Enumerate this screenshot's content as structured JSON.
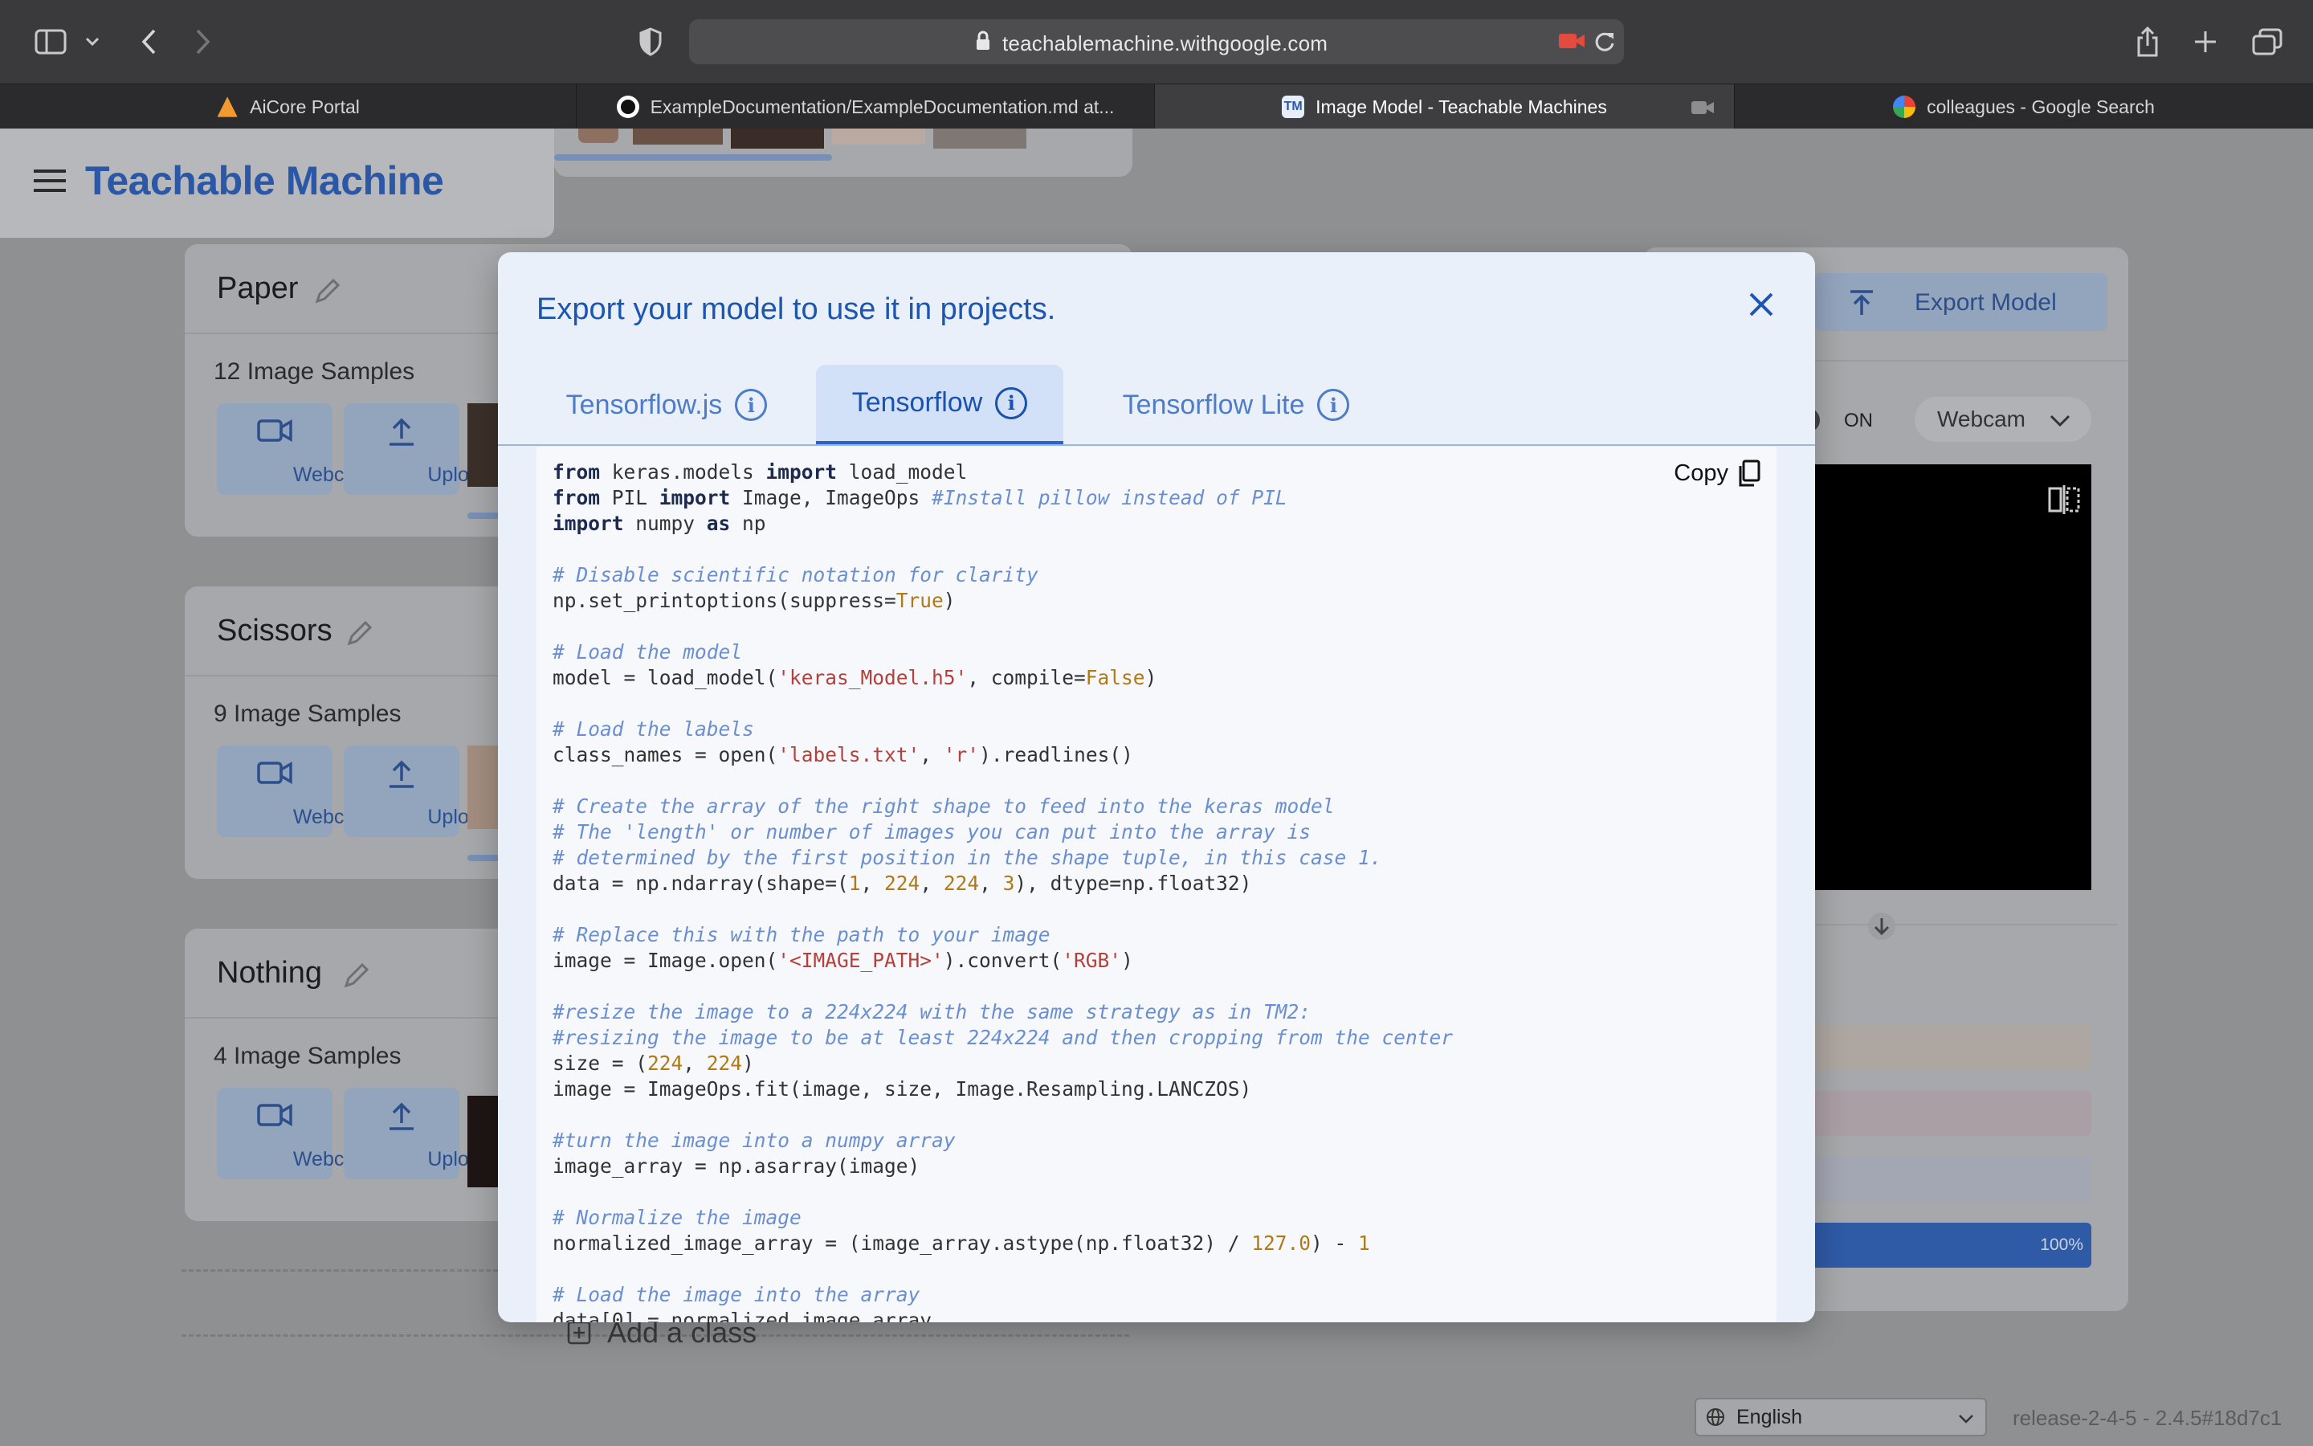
{
  "browser": {
    "url": "teachablemachine.withgoogle.com",
    "tabs": [
      {
        "title": "AiCore Portal"
      },
      {
        "title": "ExampleDocumentation/ExampleDocumentation.md at..."
      },
      {
        "title": "Image Model - Teachable Machines"
      },
      {
        "title": "colleagues - Google Search"
      }
    ]
  },
  "app": {
    "logo": "Teachable Machine",
    "classes": [
      {
        "name": "Paper",
        "samples": "12 Image Samples"
      },
      {
        "name": "Scissors",
        "samples": "9 Image Samples"
      },
      {
        "name": "Nothing",
        "samples": "4 Image Samples"
      }
    ],
    "webcam_label": "Webcam",
    "upload_label": "Upload",
    "add_class": "Add a class",
    "export_model": "Export Model",
    "preview_toggle": "ON",
    "preview_source": "Webcam",
    "confidence_label": "100%",
    "language": "English",
    "release": "release-2-4-5 - 2.4.5#18d7c1"
  },
  "modal": {
    "title": "Export your model to use it in projects.",
    "tabs": [
      "Tensorflow.js",
      "Tensorflow",
      "Tensorflow Lite"
    ],
    "active_tab": "Tensorflow",
    "copy_label": "Copy"
  },
  "colors": {
    "accent": "#1a52ad",
    "brand": "#2b57a7",
    "modal_bg": "#e9f0fa"
  }
}
